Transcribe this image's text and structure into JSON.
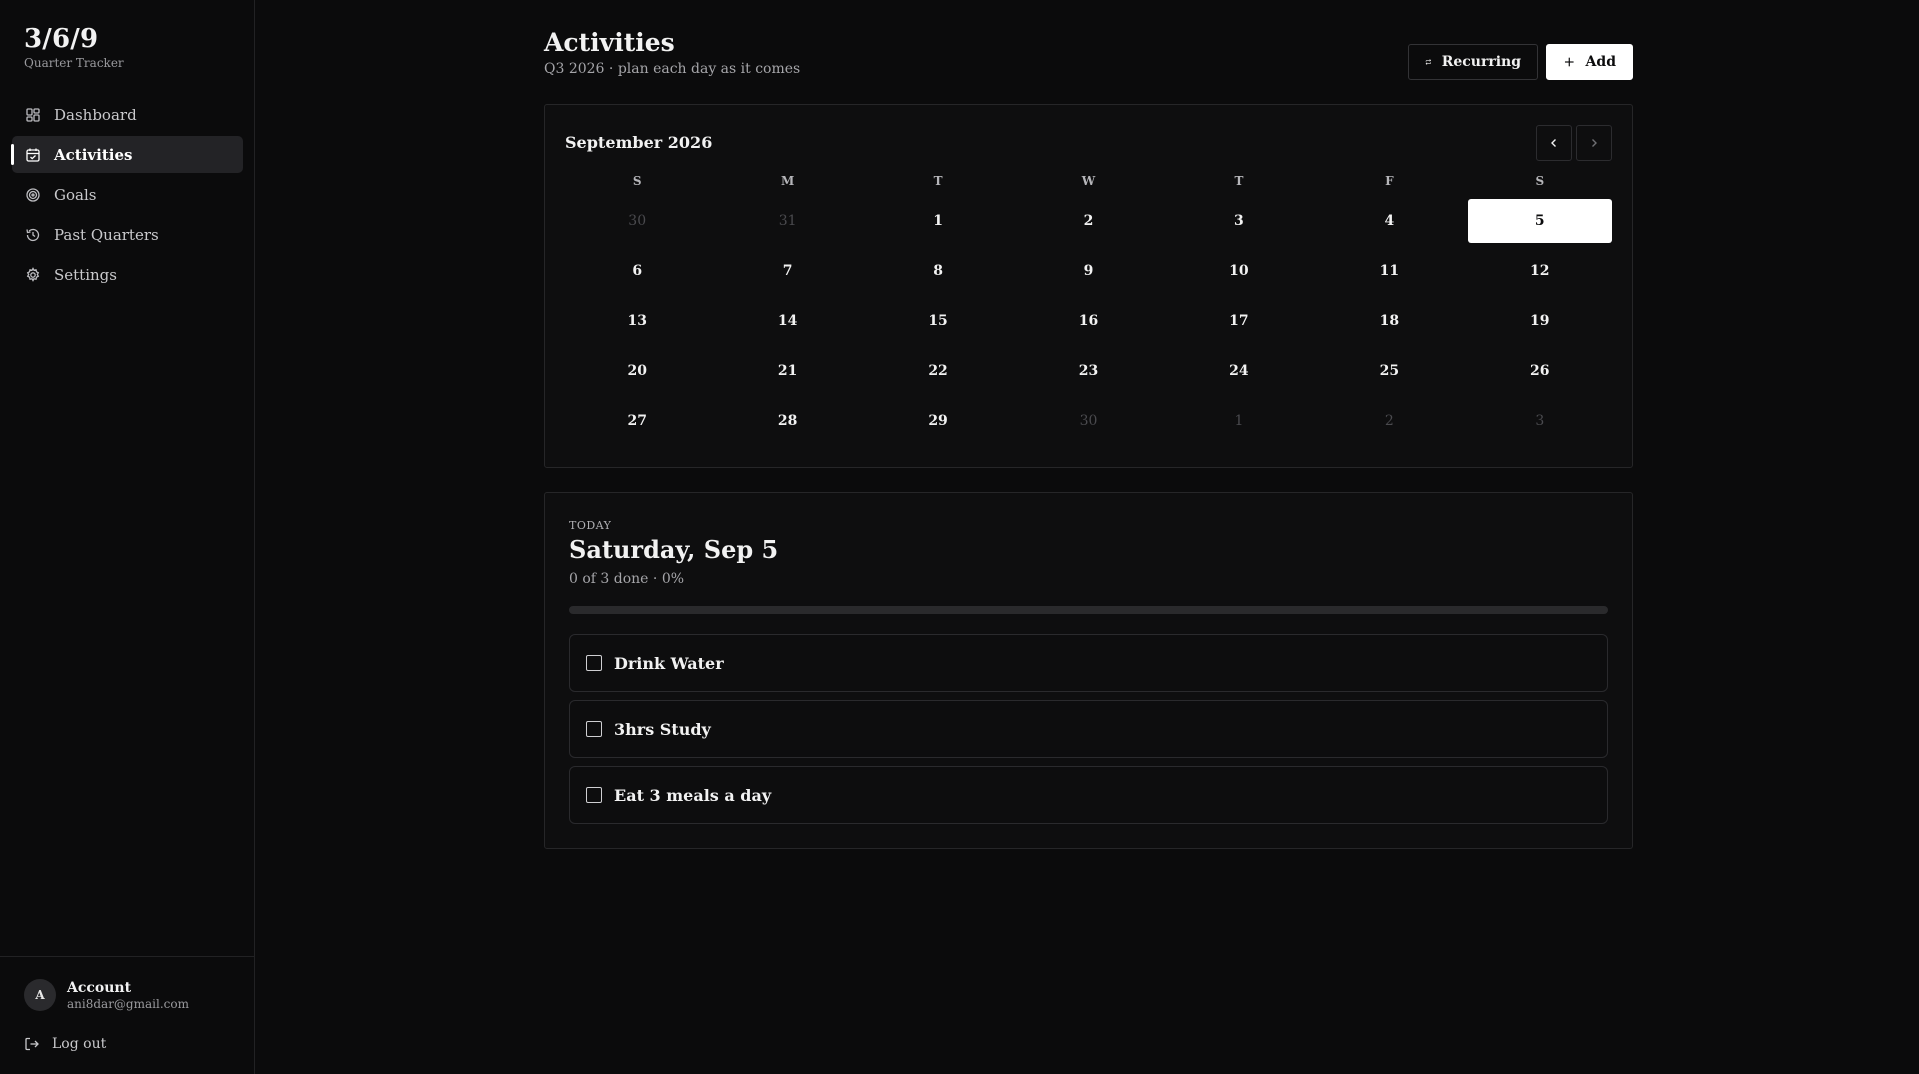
{
  "brand": {
    "title": "3/6/9",
    "subtitle": "Quarter Tracker"
  },
  "sidebar": {
    "items": [
      {
        "label": "Dashboard",
        "icon": "dashboard-icon",
        "active": false
      },
      {
        "label": "Activities",
        "icon": "calendar-icon",
        "active": true
      },
      {
        "label": "Goals",
        "icon": "target-icon",
        "active": false
      },
      {
        "label": "Past Quarters",
        "icon": "history-icon",
        "active": false
      },
      {
        "label": "Settings",
        "icon": "gear-icon",
        "active": false
      }
    ],
    "account": {
      "initial": "A",
      "name": "Account",
      "email": "ani8dar@gmail.com"
    },
    "logout_label": "Log out"
  },
  "header": {
    "title": "Activities",
    "subtitle": "Q3 2026 · plan each day as it comes",
    "recurring_label": "Recurring",
    "add_label": "Add"
  },
  "calendar": {
    "month_label": "September 2026",
    "weekdays": [
      "S",
      "M",
      "T",
      "W",
      "T",
      "F",
      "S"
    ],
    "days": [
      {
        "label": "30",
        "muted": true
      },
      {
        "label": "31",
        "muted": true
      },
      {
        "label": "1"
      },
      {
        "label": "2"
      },
      {
        "label": "3"
      },
      {
        "label": "4"
      },
      {
        "label": "5",
        "selected": true
      },
      {
        "label": "6"
      },
      {
        "label": "7"
      },
      {
        "label": "8"
      },
      {
        "label": "9"
      },
      {
        "label": "10"
      },
      {
        "label": "11"
      },
      {
        "label": "12"
      },
      {
        "label": "13"
      },
      {
        "label": "14"
      },
      {
        "label": "15"
      },
      {
        "label": "16"
      },
      {
        "label": "17"
      },
      {
        "label": "18"
      },
      {
        "label": "19"
      },
      {
        "label": "20"
      },
      {
        "label": "21"
      },
      {
        "label": "22"
      },
      {
        "label": "23"
      },
      {
        "label": "24"
      },
      {
        "label": "25"
      },
      {
        "label": "26"
      },
      {
        "label": "27"
      },
      {
        "label": "28"
      },
      {
        "label": "29"
      },
      {
        "label": "30",
        "muted": true
      },
      {
        "label": "1",
        "muted": true
      },
      {
        "label": "2",
        "muted": true
      },
      {
        "label": "3",
        "muted": true
      }
    ]
  },
  "today": {
    "label": "TODAY",
    "date": "Saturday, Sep 5",
    "progress_text": "0 of 3 done · 0%",
    "progress_fraction": 0,
    "tasks": [
      {
        "label": "Drink Water",
        "done": false
      },
      {
        "label": "3hrs Study",
        "done": false
      },
      {
        "label": "Eat 3 meals a day",
        "done": false
      }
    ]
  }
}
